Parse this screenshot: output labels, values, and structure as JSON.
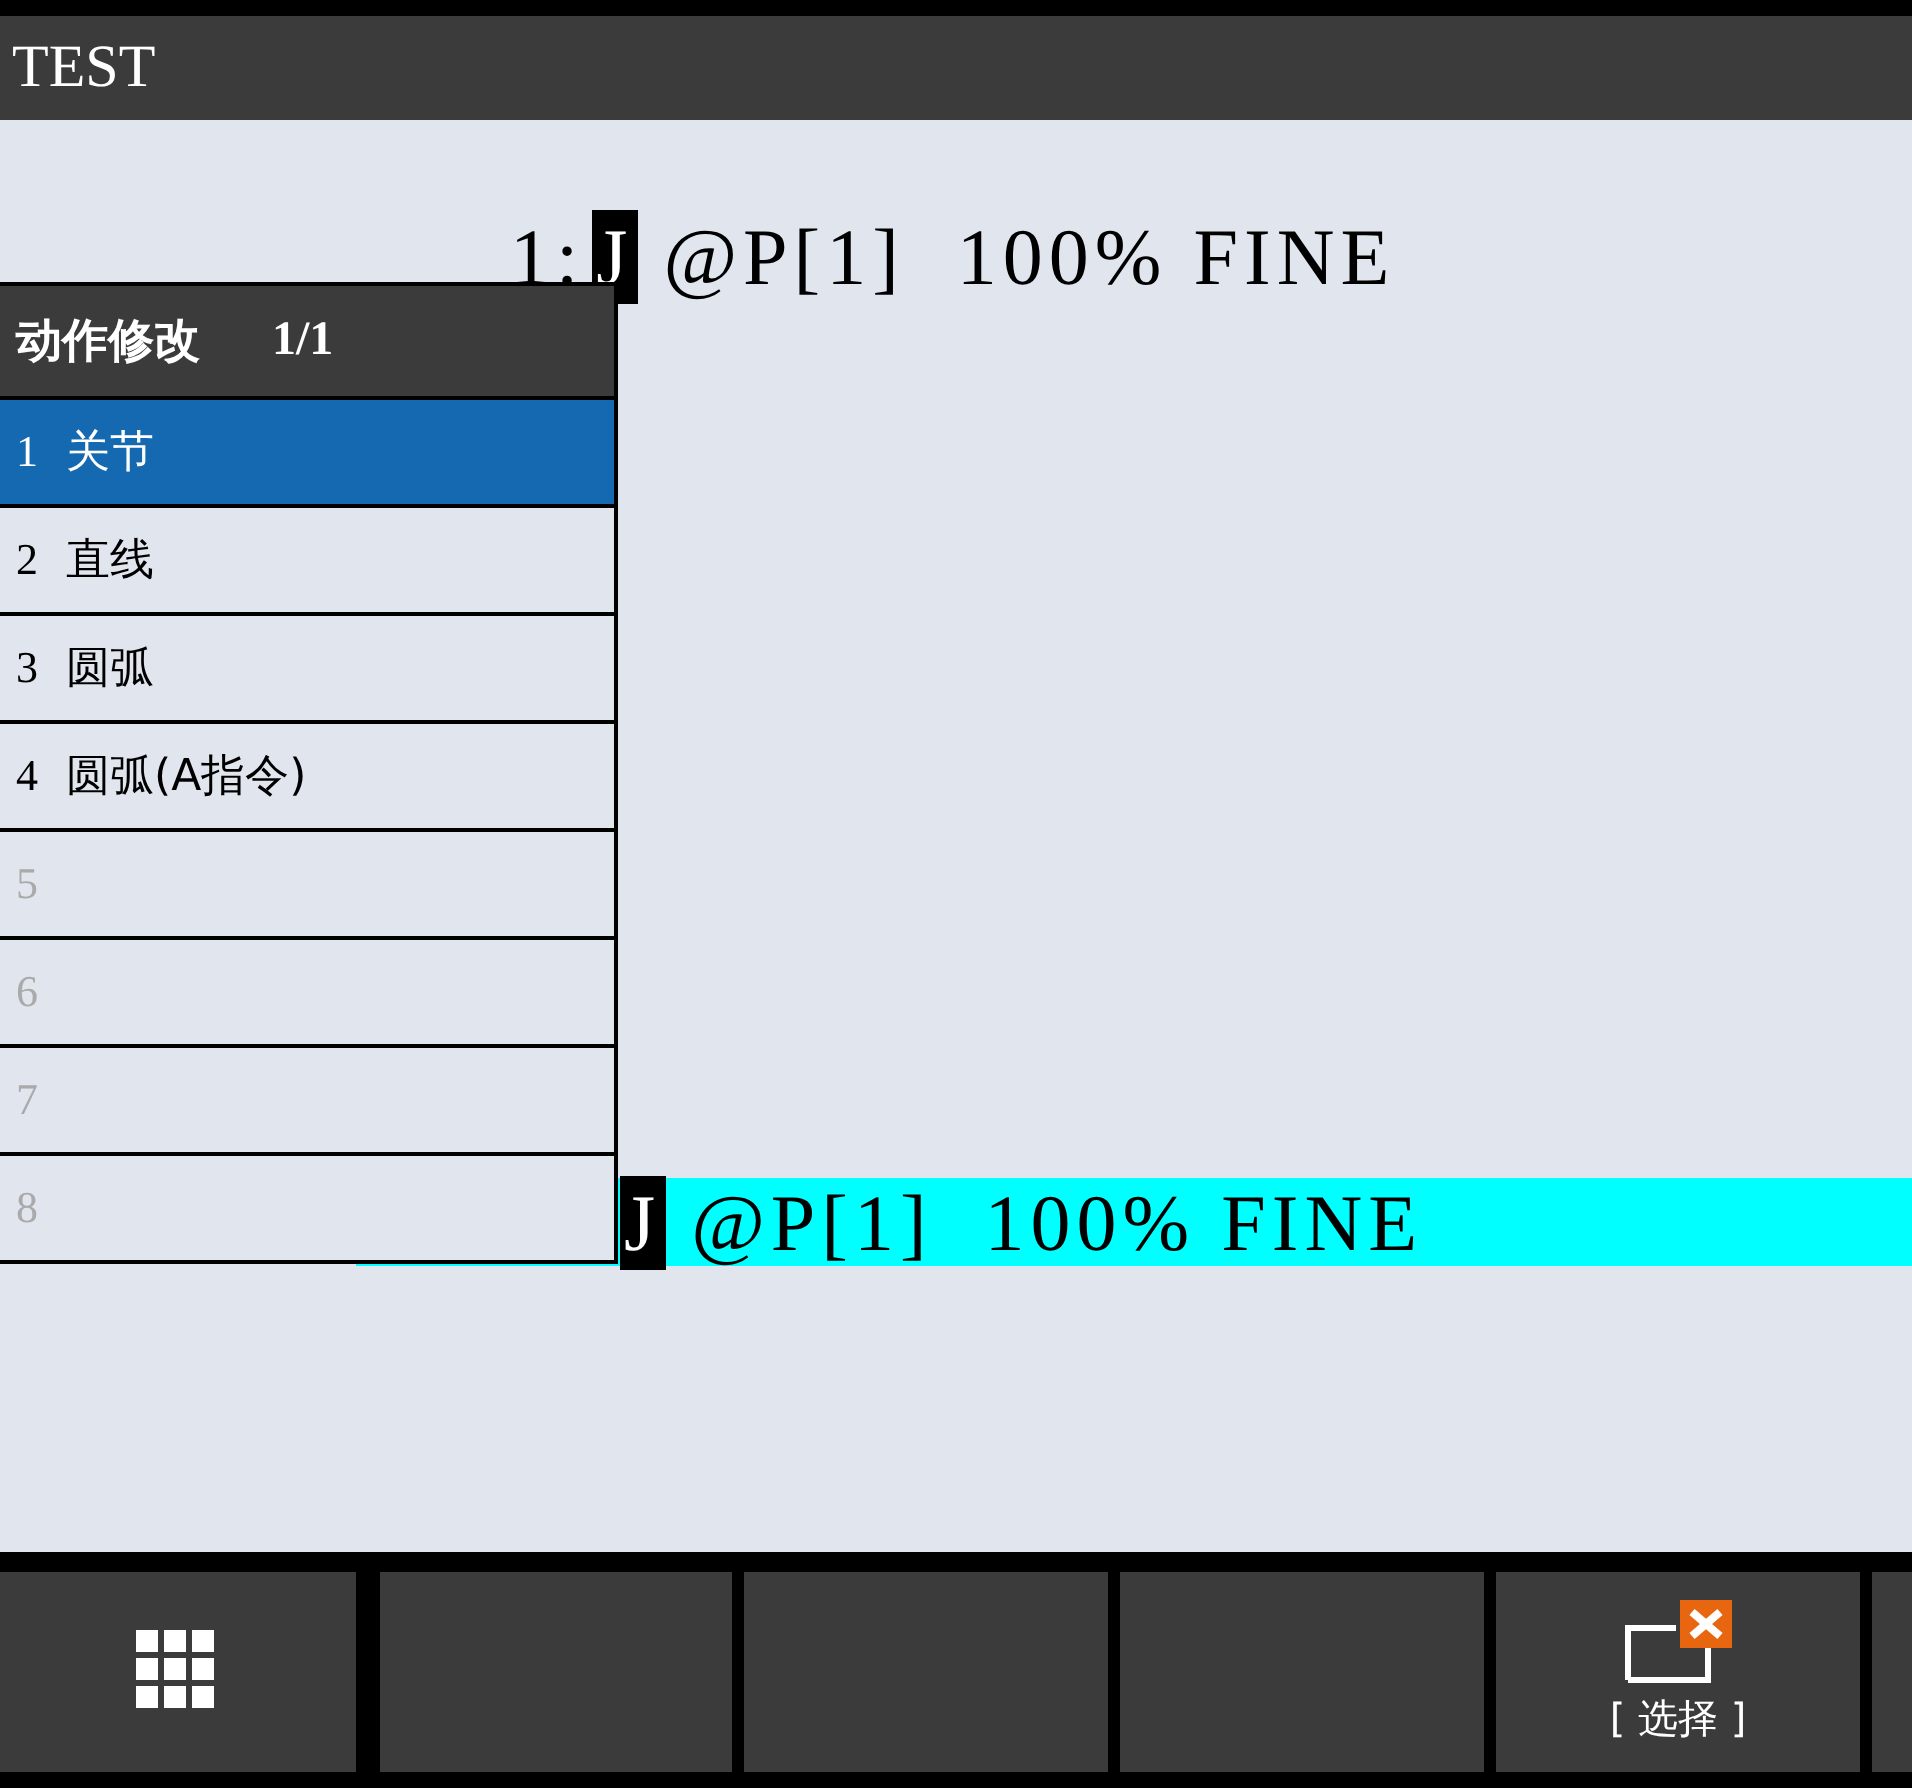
{
  "window": {
    "title": "TEST"
  },
  "program_lines": [
    {
      "number": "1:",
      "cursor": "J",
      "text": " @P[1]  100% FINE",
      "selected": false
    },
    {
      "cursor": "J",
      "text": " @P[1]  100% FINE",
      "selected": true
    }
  ],
  "popup": {
    "title": "动作修改",
    "page": "1/1",
    "items": [
      {
        "number": "1",
        "label": "关节",
        "selected": true,
        "disabled": false
      },
      {
        "number": "2",
        "label": "直线",
        "selected": false,
        "disabled": false
      },
      {
        "number": "3",
        "label": "圆弧",
        "selected": false,
        "disabled": false
      },
      {
        "number": "4",
        "label": "圆弧(A指令)",
        "selected": false,
        "disabled": false
      },
      {
        "number": "5",
        "selected": false,
        "disabled": true
      },
      {
        "number": "6",
        "selected": false,
        "disabled": true
      },
      {
        "number": "7",
        "selected": false,
        "disabled": true
      },
      {
        "number": "8",
        "selected": false,
        "disabled": true
      }
    ]
  },
  "function_keys": [
    {
      "kind": "menu"
    },
    {
      "kind": "empty"
    },
    {
      "kind": "empty"
    },
    {
      "kind": "empty"
    },
    {
      "kind": "select",
      "label": "[ 选择 ]"
    },
    {
      "kind": "empty"
    }
  ]
}
